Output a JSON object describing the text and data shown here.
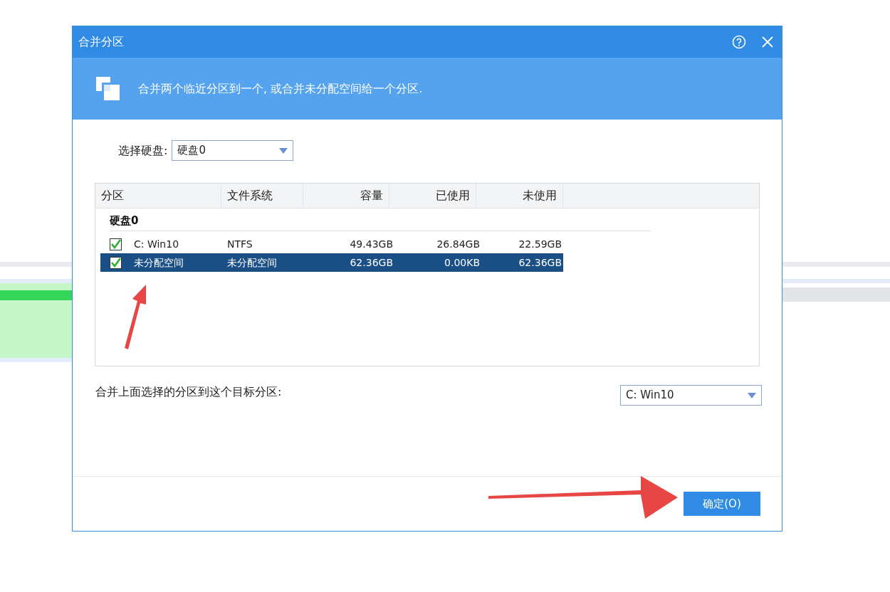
{
  "window": {
    "title": "合并分区"
  },
  "header": {
    "description": "合并两个临近分区到一个, 或合并未分配空间给一个分区."
  },
  "disk_select": {
    "label": "选择硬盘:",
    "value": "硬盘0"
  },
  "table": {
    "columns": [
      "分区",
      "文件系统",
      "容量",
      "已使用",
      "未使用"
    ],
    "groups": [
      {
        "name": "硬盘0",
        "rows": [
          {
            "cells": [
              "C:  Win10",
              "NTFS",
              "49.43GB",
              "26.84GB",
              "22.59GB"
            ],
            "checked": true,
            "selected": false
          },
          {
            "cells": [
              "未分配空间",
              "未分配空间",
              "62.36GB",
              "0.00KB",
              "62.36GB"
            ],
            "checked": true,
            "selected": true
          }
        ]
      }
    ]
  },
  "target": {
    "label": "合并上面选择的分区到这个目标分区:",
    "value": "C:  Win10"
  },
  "buttons": [
    {
      "label": "确定(O)"
    }
  ]
}
